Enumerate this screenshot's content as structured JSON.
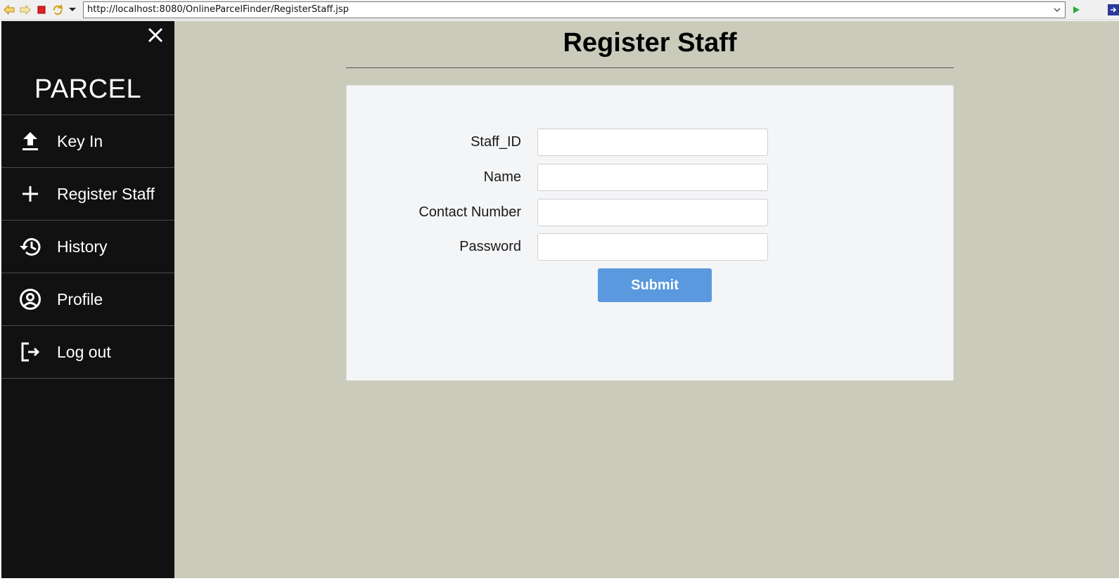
{
  "browser": {
    "url": "http://localhost:8080/OnlineParcelFinder/RegisterStaff.jsp",
    "back_icon": "arrow-left-icon",
    "forward_icon": "arrow-right-icon",
    "stop_icon": "stop-icon",
    "refresh_icon": "refresh-icon",
    "menu_icon": "chevron-down-icon",
    "go_icon": "play-icon"
  },
  "sidebar": {
    "brand": "PARCEL",
    "items": [
      {
        "label": "Key In",
        "icon": "upload-icon"
      },
      {
        "label": "Register Staff",
        "icon": "plus-icon"
      },
      {
        "label": "History",
        "icon": "history-icon"
      },
      {
        "label": "Profile",
        "icon": "account-circle-icon"
      },
      {
        "label": "Log out",
        "icon": "logout-icon"
      }
    ]
  },
  "main": {
    "title": "Register Staff",
    "form": {
      "fields": [
        {
          "label": "Staff_ID",
          "value": "",
          "type": "text"
        },
        {
          "label": "Name",
          "value": "",
          "type": "text"
        },
        {
          "label": "Contact Number",
          "value": "",
          "type": "text"
        },
        {
          "label": "Password",
          "value": "",
          "type": "password"
        }
      ],
      "submit_label": "Submit"
    }
  },
  "colors": {
    "sidebar_bg": "#111111",
    "main_bg": "#cbcbbc",
    "card_bg": "#f4f5f7",
    "submit_bg": "#5a99de"
  }
}
